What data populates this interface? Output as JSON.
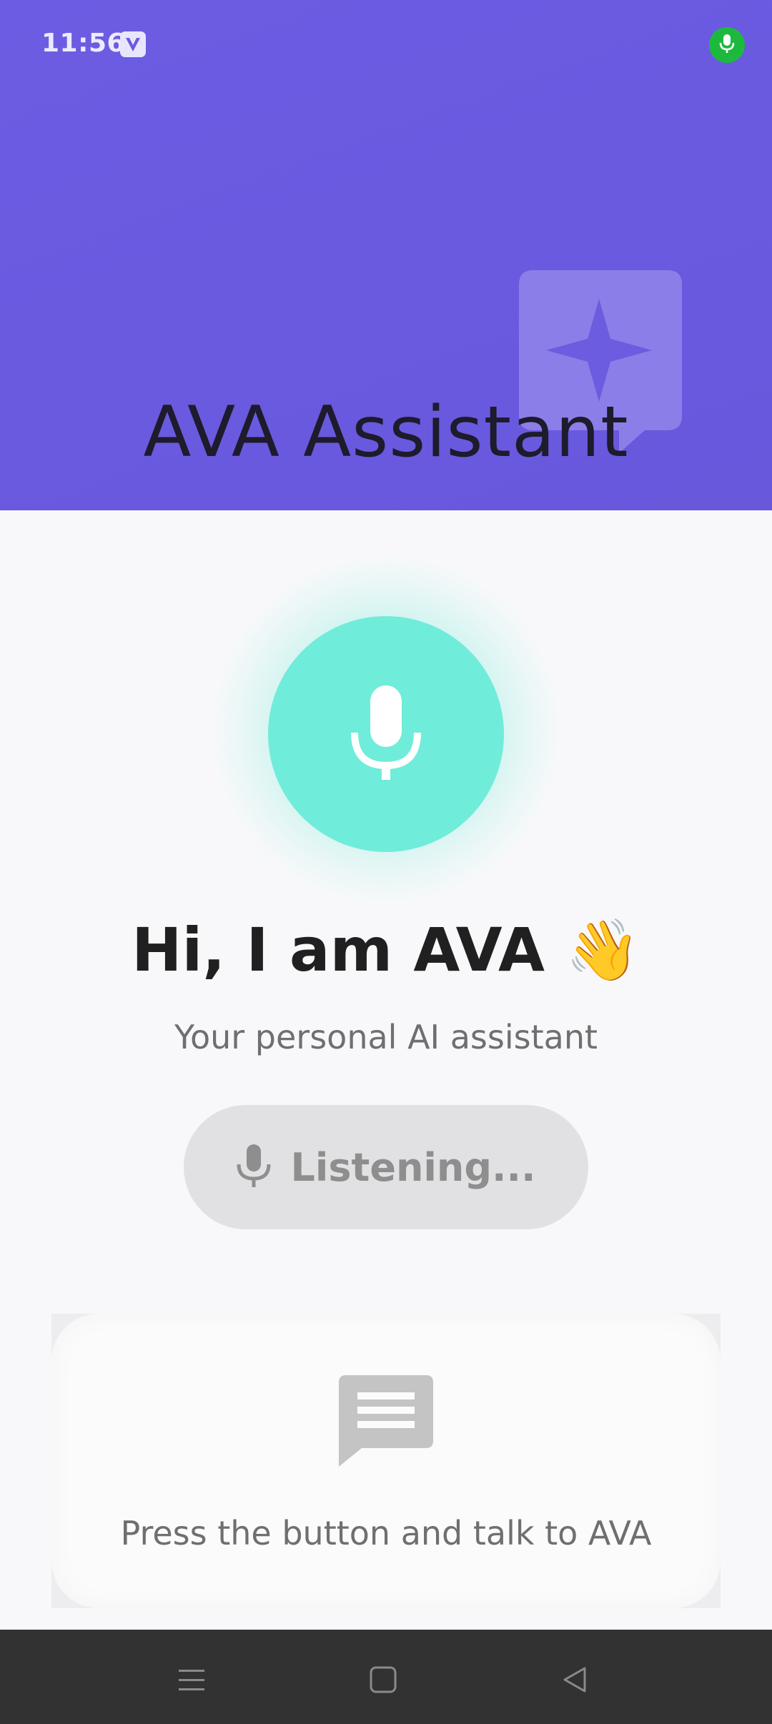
{
  "status_bar": {
    "time": "11:56",
    "app_icon": "v-app-icon",
    "mic_indicator_icon": "microphone-icon",
    "mic_indicator_color": "#1db93f"
  },
  "header": {
    "title": "AVA Assistant",
    "background_color": "#6a5ae0",
    "decoration_icon": "sparkle-chat-bubble-icon"
  },
  "mic_button": {
    "icon": "microphone-icon",
    "color": "#70ecda"
  },
  "greeting": "Hi, I am AVA 👋",
  "subtitle": "Your personal AI assistant",
  "listening_button": {
    "icon": "microphone-icon",
    "label": "Listening..."
  },
  "info_card": {
    "icon": "chat-message-icon",
    "text": "Press the button and talk to AVA"
  },
  "nav_bar": {
    "items": [
      "menu-icon",
      "home-square-icon",
      "back-triangle-icon"
    ]
  }
}
